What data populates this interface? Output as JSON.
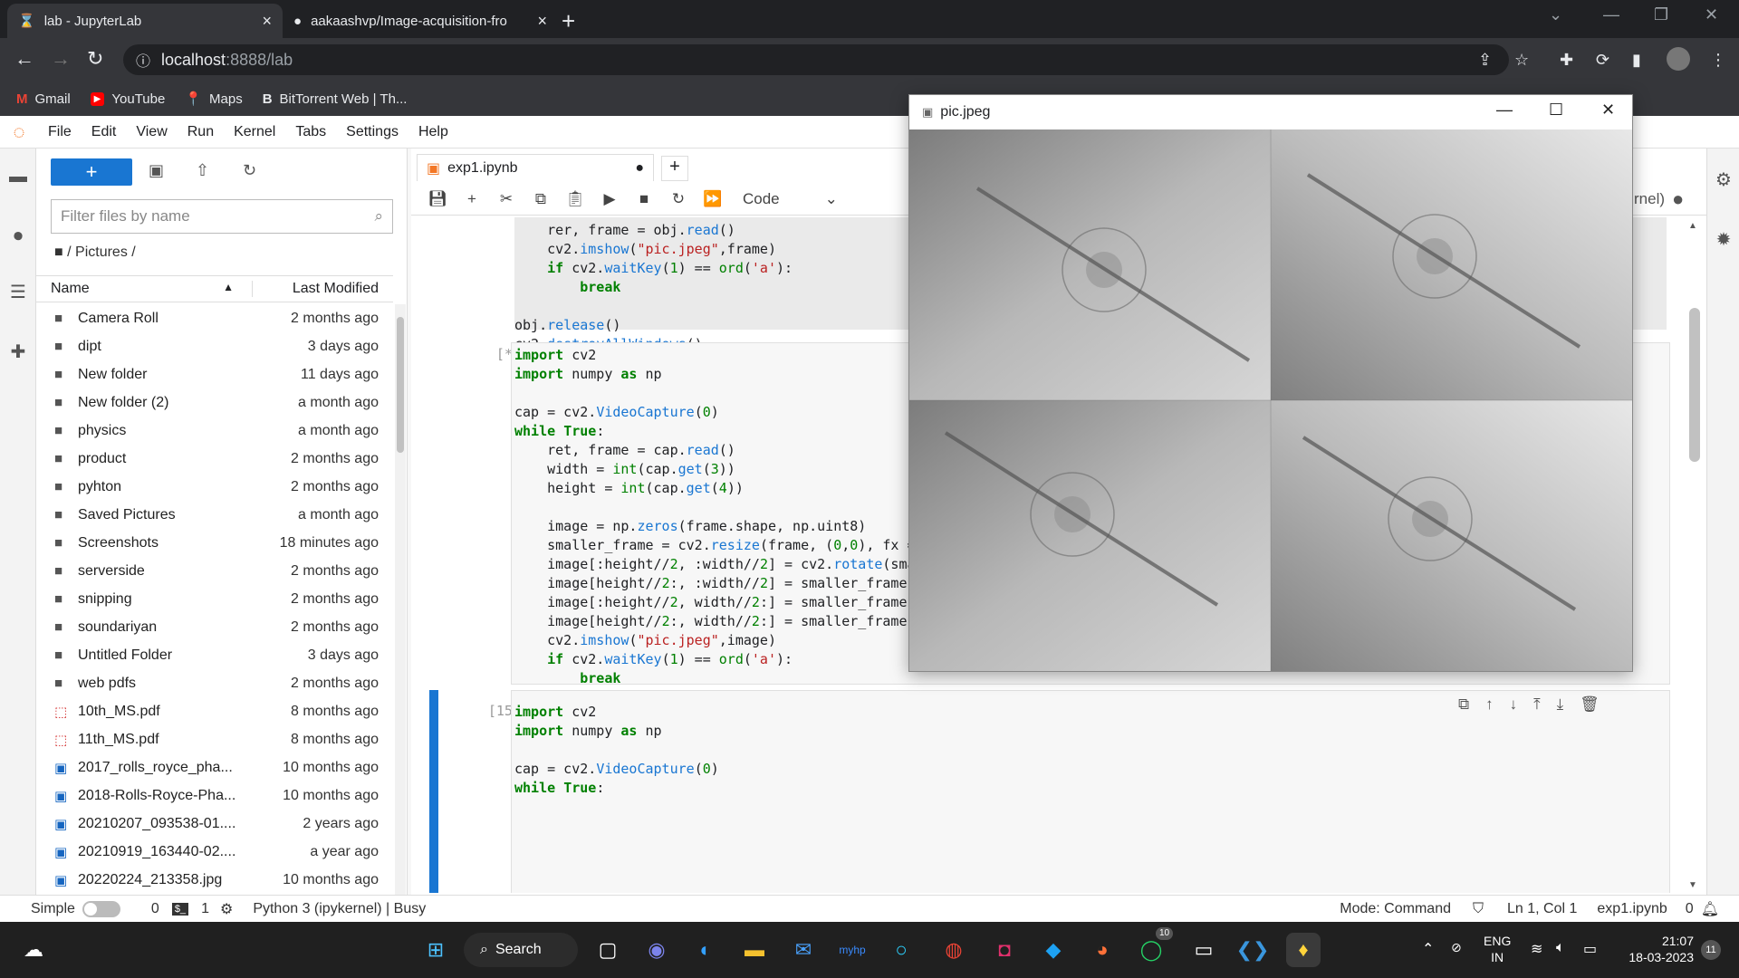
{
  "browser": {
    "tabs": [
      {
        "title": "lab - JupyterLab",
        "icon": "hourglass-icon"
      },
      {
        "title": "aakaashvp/Image-acquisition-fro",
        "icon": "github-icon"
      }
    ],
    "address_host": "localhost",
    "address_path": ":8888/lab",
    "bookmarks": [
      "Gmail",
      "YouTube",
      "Maps",
      "BitTorrent Web | Th..."
    ]
  },
  "jupyter": {
    "menu": [
      "File",
      "Edit",
      "View",
      "Run",
      "Kernel",
      "Tabs",
      "Settings",
      "Help"
    ],
    "filter_placeholder": "Filter files by name",
    "breadcrumb": "/ Pictures /",
    "col_name": "Name",
    "col_modified": "Last Modified",
    "files": [
      {
        "name": "Camera Roll",
        "modified": "2 months ago",
        "type": "folder"
      },
      {
        "name": "dipt",
        "modified": "3 days ago",
        "type": "folder"
      },
      {
        "name": "New folder",
        "modified": "11 days ago",
        "type": "folder"
      },
      {
        "name": "New folder (2)",
        "modified": "a month ago",
        "type": "folder"
      },
      {
        "name": "physics",
        "modified": "a month ago",
        "type": "folder"
      },
      {
        "name": "product",
        "modified": "2 months ago",
        "type": "folder"
      },
      {
        "name": "pyhton",
        "modified": "2 months ago",
        "type": "folder"
      },
      {
        "name": "Saved Pictures",
        "modified": "a month ago",
        "type": "folder"
      },
      {
        "name": "Screenshots",
        "modified": "18 minutes ago",
        "type": "folder"
      },
      {
        "name": "serverside",
        "modified": "2 months ago",
        "type": "folder"
      },
      {
        "name": "snipping",
        "modified": "2 months ago",
        "type": "folder"
      },
      {
        "name": "soundariyan",
        "modified": "2 months ago",
        "type": "folder"
      },
      {
        "name": "Untitled Folder",
        "modified": "3 days ago",
        "type": "folder"
      },
      {
        "name": "web pdfs",
        "modified": "2 months ago",
        "type": "folder"
      },
      {
        "name": "10th_MS.pdf",
        "modified": "8 months ago",
        "type": "pdf"
      },
      {
        "name": "11th_MS.pdf",
        "modified": "8 months ago",
        "type": "pdf"
      },
      {
        "name": "2017_rolls_royce_pha...",
        "modified": "10 months ago",
        "type": "image"
      },
      {
        "name": "2018-Rolls-Royce-Pha...",
        "modified": "10 months ago",
        "type": "image"
      },
      {
        "name": "20210207_093538-01....",
        "modified": "2 years ago",
        "type": "image"
      },
      {
        "name": "20210919_163440-02....",
        "modified": "a year ago",
        "type": "image"
      },
      {
        "name": "20220224_213358.jpg",
        "modified": "10 months ago",
        "type": "image"
      }
    ],
    "notebook_tab": "exp1.ipynb",
    "cell_type": "Code",
    "kernel_label": "rnel)",
    "prompt_running": "[*]:",
    "prompt_15": "[15]:",
    "status": {
      "mode_label": "Simple",
      "term_count": "0",
      "kernel_count": "1",
      "kernel": "Python 3 (ipykernel) | Busy",
      "mode": "Mode: Command",
      "position": "Ln 1, Col 1",
      "file": "exp1.ipynb",
      "notifications": "0"
    }
  },
  "popup": {
    "title": "pic.jpeg"
  },
  "taskbar": {
    "search": "Search",
    "lang1": "ENG",
    "lang2": "IN",
    "time": "21:07",
    "date": "18-03-2023",
    "whatsapp_badge": "10",
    "notif_badge": "11"
  }
}
